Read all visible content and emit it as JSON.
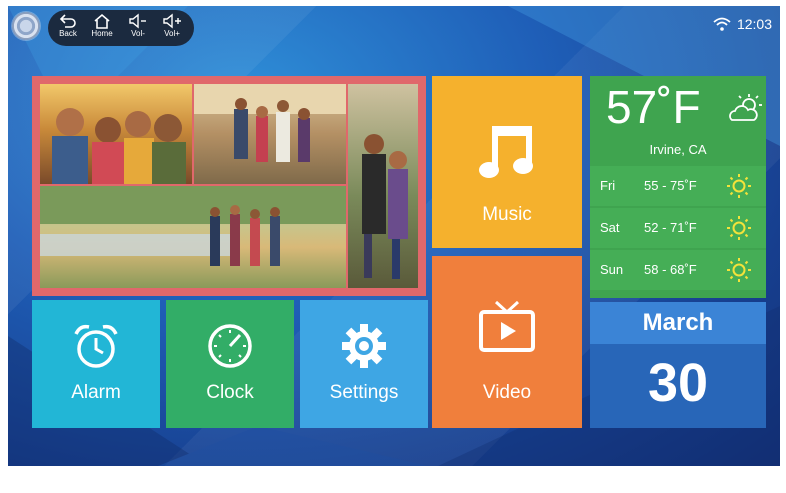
{
  "statusbar": {
    "nav": [
      {
        "label": "Back",
        "icon": "back-arrow-icon"
      },
      {
        "label": "Home",
        "icon": "home-icon"
      },
      {
        "label": "Vol-",
        "icon": "volume-down-icon"
      },
      {
        "label": "Vol+",
        "icon": "volume-up-icon"
      }
    ],
    "time": "12:03",
    "wifi_icon": "wifi-icon"
  },
  "tiles": {
    "music": {
      "label": "Music",
      "color": "#f5b12d"
    },
    "video": {
      "label": "Video",
      "color": "#f07f3c"
    },
    "alarm": {
      "label": "Alarm",
      "color": "#22b6d6"
    },
    "clock": {
      "label": "Clock",
      "color": "#32ad67"
    },
    "settings": {
      "label": "Settings",
      "color": "#3ea6e4"
    }
  },
  "weather": {
    "temp": "57˚F",
    "location": "Irvine, CA",
    "forecast": [
      {
        "day": "Fri",
        "range": "55 - 75˚F"
      },
      {
        "day": "Sat",
        "range": "52 - 71˚F"
      },
      {
        "day": "Sun",
        "range": "58 - 68˚F"
      }
    ]
  },
  "date": {
    "month": "March",
    "day": "30"
  },
  "colors": {
    "photo_frame": "#e0686b",
    "weather": "#3fa44f",
    "date": "#2866b8",
    "date_header": "#3b84d6"
  }
}
